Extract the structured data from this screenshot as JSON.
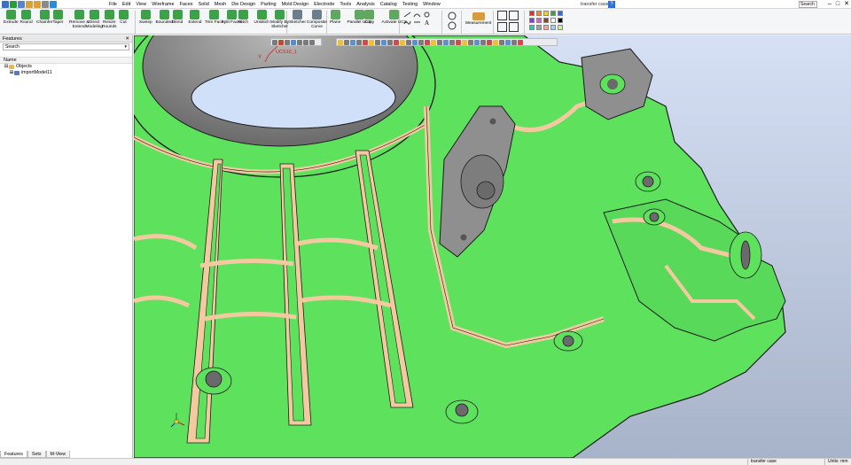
{
  "app": {
    "window_title": "transfer case",
    "help_label": "?",
    "search_placeholder": "Search",
    "window_controls": [
      "–",
      "□",
      "✕"
    ]
  },
  "menu": [
    "File",
    "Edit",
    "View",
    "Wireframe",
    "Faces",
    "Solid",
    "Mesh",
    "Die Design",
    "Parting",
    "Mold Design",
    "Electrode",
    "Tools",
    "Analysis",
    "Catalog",
    "Testing",
    "Window"
  ],
  "ribbon": {
    "create_tools": [
      {
        "label": "Extrude",
        "icon": "extrude-icon"
      },
      {
        "label": "Round",
        "icon": "round-icon"
      },
      {
        "label": "Chamfer",
        "icon": "chamfer-icon"
      },
      {
        "label": "Taper",
        "icon": "taper-icon"
      },
      {
        "label": "Remove &\nExtend",
        "icon": "remove-extend-icon"
      },
      {
        "label": "Direct\nModeling",
        "icon": "direct-modeling-icon"
      },
      {
        "label": "Resize\nRounds",
        "icon": "resize-rounds-icon"
      },
      {
        "label": "Cut",
        "icon": "cut-icon"
      }
    ],
    "faces_tools": [
      {
        "label": "Sweep",
        "icon": "sweep-icon"
      },
      {
        "label": "Bounded",
        "icon": "bounded-icon"
      },
      {
        "label": "Blend",
        "icon": "blend-icon"
      },
      {
        "label": "Extend",
        "icon": "extend-icon"
      },
      {
        "label": "Trim Face",
        "icon": "trim-face-icon"
      },
      {
        "label": "Split Faces",
        "icon": "split-faces-icon"
      },
      {
        "label": "Stitch",
        "icon": "stitch-icon"
      },
      {
        "label": "Unstitch",
        "icon": "unstitch-icon"
      },
      {
        "label": "Modify By\nSketcher",
        "icon": "modify-sketcher-icon"
      }
    ],
    "sketch_tools": [
      {
        "label": "Sketcher",
        "icon": "sketcher-icon"
      },
      {
        "label": "Composite\nCurve",
        "icon": "composite-curve-icon"
      }
    ],
    "ucs_tools": [
      {
        "label": "Plane",
        "icon": "plane-icon"
      },
      {
        "label": "Parallel UCS",
        "icon": "parallel-ucs-icon"
      },
      {
        "label": "Copy",
        "icon": "copy-icon"
      },
      {
        "label": "Activate UCS",
        "icon": "activate-ucs-icon"
      }
    ],
    "measure_label": "Measurement"
  },
  "panel": {
    "title": "Features",
    "close": "✕",
    "search_value": "Search",
    "column_header": "Name",
    "tree": [
      {
        "label": "Objects",
        "toggle": "⊟",
        "icon": "objects-folder-icon",
        "indent": 0
      },
      {
        "label": "importModel11",
        "toggle": "⊞",
        "icon": "part-icon",
        "indent": 1
      }
    ],
    "tabs": [
      "Features",
      "Sets",
      "M-View"
    ]
  },
  "viewport": {
    "ucs_label": "UCS10_1",
    "axis_y": "Y"
  },
  "status": {
    "doc": "transfer case",
    "units": "Units: mm"
  },
  "colors": {
    "model_face": "#5ee25e",
    "fillet": "#f3c9a0",
    "bore": "#8f8f8f",
    "bg_top": "#cfdaf2",
    "bg_bottom": "#aab7cf",
    "accent": "#2d6fd6"
  }
}
